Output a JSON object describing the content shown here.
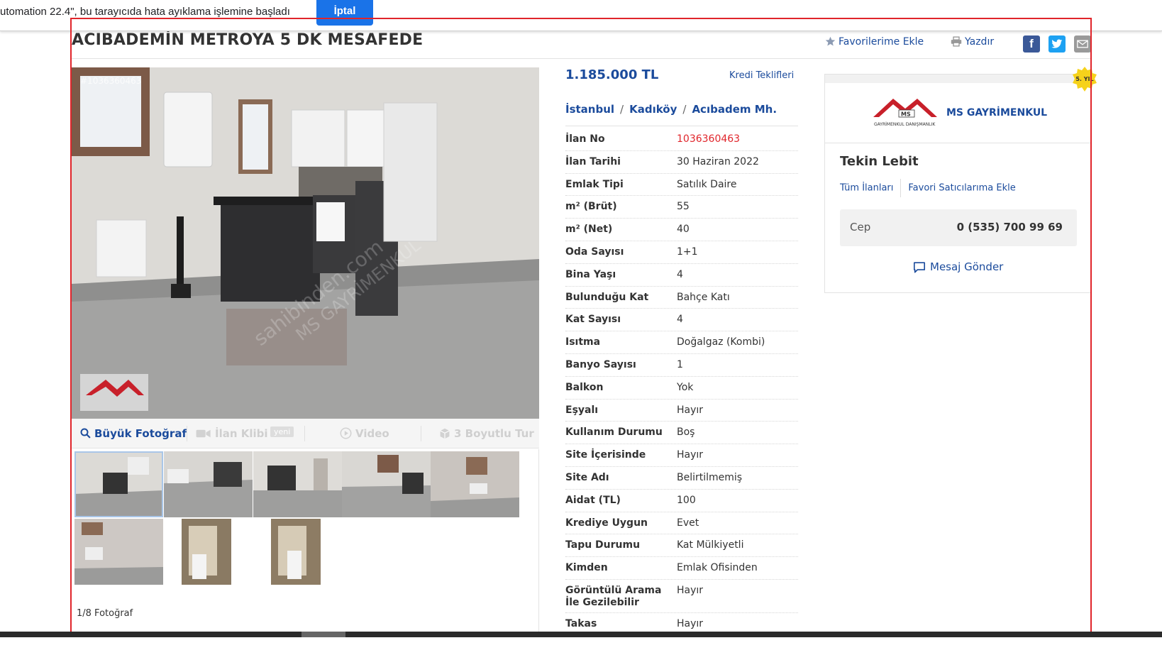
{
  "debug_bar": {
    "text": "utomation 22.4\", bu tarayıcıda hata ayıklama işlemine başladı",
    "cancel_label": "İptal"
  },
  "listing": {
    "title": "ACIBADEMİN METROYA 5 DK MESAFEDE",
    "actions": {
      "favorite": "Favorilerime Ekle",
      "print": "Yazdır"
    },
    "share_icons": [
      "facebook-icon",
      "twitter-icon",
      "mail-icon"
    ],
    "price": "1.185.000 TL",
    "credit_link": "Kredi Teklifleri",
    "location": [
      "İstanbul",
      "Kadıköy",
      "Acıbadem Mh."
    ]
  },
  "photos": {
    "watermark_id": "#1036360463",
    "toolbar": {
      "big_photo": "Büyük Fotoğraf",
      "clip": "İlan Klibi",
      "clip_badge": "yeni",
      "video": "Video",
      "tour": "3 Boyutlu Tur"
    },
    "count_text": "1/8 Fotoğraf"
  },
  "details": [
    {
      "label": "İlan No",
      "value": "1036360463",
      "highlight": true
    },
    {
      "label": "İlan Tarihi",
      "value": "30 Haziran 2022"
    },
    {
      "label": "Emlak Tipi",
      "value": "Satılık Daire"
    },
    {
      "label": "m² (Brüt)",
      "value": "55"
    },
    {
      "label": "m² (Net)",
      "value": "40"
    },
    {
      "label": "Oda Sayısı",
      "value": "1+1"
    },
    {
      "label": "Bina Yaşı",
      "value": "4"
    },
    {
      "label": "Bulunduğu Kat",
      "value": "Bahçe Katı"
    },
    {
      "label": "Kat Sayısı",
      "value": "4"
    },
    {
      "label": "Isıtma",
      "value": "Doğalgaz (Kombi)"
    },
    {
      "label": "Banyo Sayısı",
      "value": "1"
    },
    {
      "label": "Balkon",
      "value": "Yok"
    },
    {
      "label": "Eşyalı",
      "value": "Hayır"
    },
    {
      "label": "Kullanım Durumu",
      "value": "Boş"
    },
    {
      "label": "Site İçerisinde",
      "value": "Hayır"
    },
    {
      "label": "Site Adı",
      "value": "Belirtilmemiş"
    },
    {
      "label": "Aidat (TL)",
      "value": "100"
    },
    {
      "label": "Krediye Uygun",
      "value": "Evet"
    },
    {
      "label": "Tapu Durumu",
      "value": "Kat Mülkiyetli"
    },
    {
      "label": "Kimden",
      "value": "Emlak Ofisinden"
    },
    {
      "label": "Görüntülü Arama İle Gezilebilir",
      "value": "Hayır"
    },
    {
      "label": "Takas",
      "value": "Hayır"
    }
  ],
  "seller": {
    "badge": "5. YIL",
    "logo_text": "MS",
    "logo_caption": "GAYRİMENKUL DANIŞMANLIK",
    "company": "MS GAYRİMENKUL",
    "name": "Tekin Lebit",
    "all_listings": "Tüm İlanları",
    "add_favorite_seller": "Favori Satıcılarıma Ekle",
    "phone_label": "Cep",
    "phone_number": "0 (535) 700 99 69",
    "message_button": "Mesaj Gönder"
  },
  "colors": {
    "link_blue": "#1b4b9c",
    "highlight_red": "#e0252b",
    "badge_yellow": "#f6d21b"
  }
}
